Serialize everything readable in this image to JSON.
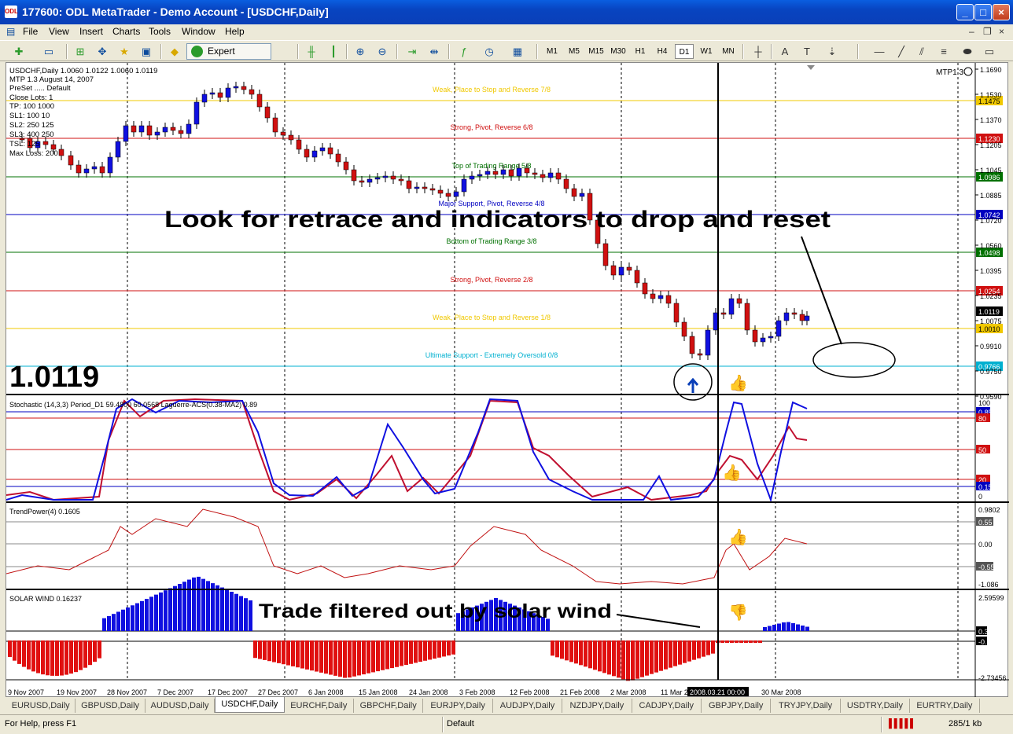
{
  "window": {
    "title": "177600: ODL MetaTrader - Demo Account - [USDCHF,Daily]",
    "app_badge": "ODL"
  },
  "menu": [
    "File",
    "View",
    "Insert",
    "Charts",
    "Tools",
    "Window",
    "Help"
  ],
  "toolbar": {
    "expert_advisors_label": "Expert Advisors",
    "timeframes": [
      "M1",
      "M5",
      "M15",
      "M30",
      "H1",
      "H4",
      "D1",
      "W1",
      "MN"
    ],
    "active_timeframe": "D1"
  },
  "chart": {
    "header_lines": [
      "USDCHF,Daily  1.0060 1.0122 1.0060 1.0119",
      "MTP 1.3  August 14, 2007",
      "PreSet ..... Default",
      "Close Lots:  1",
      "TP:  100  1000",
      "SL1:  100  10",
      "SL2:  250  125",
      "SL3:  400  250",
      "TSL:  125",
      "Max Loss:  200"
    ],
    "corner_label": "MTP1.3",
    "big_price": "1.0119",
    "annotation_main": "Look for retrace and indicators to drop and reset",
    "annotation_solar": "Trade filtered out by solar wind",
    "price_axis": [
      "1.1690",
      "1.1530",
      "1.1370",
      "1.1205",
      "1.1045",
      "1.0885",
      "1.0720",
      "1.0560",
      "1.0395",
      "1.0235",
      "1.0075",
      "0.9910",
      "0.9750",
      "0.9590"
    ],
    "levels": [
      {
        "label": "Weak, Place to Stop and Reverse  7/8",
        "price": "1.1475",
        "color": "#f0c800",
        "badge_bg": "#f0c800",
        "badge_fg": "#000"
      },
      {
        "label": "Strong, Pivot, Reverse  6/8",
        "price": "1.1230",
        "color": "#d01010",
        "badge_bg": "#d01010",
        "badge_fg": "#fff"
      },
      {
        "label": "Top of Trading Range  5/8",
        "price": "1.0986",
        "color": "#007000",
        "badge_bg": "#007000",
        "badge_fg": "#fff"
      },
      {
        "label": "Major Support, Pivot, Reverse  4/8",
        "price": "1.0742",
        "color": "#0000c0",
        "badge_bg": "#0000c0",
        "badge_fg": "#fff"
      },
      {
        "label": "Bottom of Trading Range  3/8",
        "price": "1.0498",
        "color": "#007000",
        "badge_bg": "#007000",
        "badge_fg": "#fff"
      },
      {
        "label": "Strong, Pivot, Reverse  2/8",
        "price": "1.0254",
        "color": "#d01010",
        "badge_bg": "#d01010",
        "badge_fg": "#fff"
      },
      {
        "label": "Weak, Place to Stop and Reverse  1/8",
        "price": "1.0010",
        "color": "#f0c800",
        "badge_bg": "#f0c800",
        "badge_fg": "#000"
      },
      {
        "label": "Ultimate Support - Extremely Oversold  0/8",
        "price": "0.9766",
        "color": "#00b0d0",
        "badge_bg": "#00b0d0",
        "badge_fg": "#fff"
      }
    ],
    "current_price_badge": "1.0119",
    "stochastic_label": "Stochastic (14,3,3) Period_D1 59.4800 60.0568  Laguerre-ACS(0.38-MA2) 0.89",
    "stoch_axis": [
      "100",
      "0.85",
      "80",
      "50",
      "20",
      "0.15",
      "0"
    ],
    "trendpower_label": "TrendPower(4) 0.1605",
    "trendpower_axis": [
      "0.9802",
      "0.55",
      "0.00",
      "-0.55",
      "-1.086"
    ],
    "solar_label": "SOLAR WIND 0.16237",
    "solar_axis": [
      "2.59599",
      "0.3",
      "-0.3",
      "-2.73456"
    ],
    "date_axis": [
      "9 Nov 2007",
      "19 Nov 2007",
      "28 Nov 2007",
      "7 Dec 2007",
      "17 Dec 2007",
      "27 Dec 2007",
      "6 Jan 2008",
      "15 Jan 2008",
      "24 Jan 2008",
      "3 Feb 2008",
      "12 Feb 2008",
      "21 Feb 2008",
      "2 Mar 2008",
      "11 Mar 2008",
      "30 Mar 2008"
    ],
    "cursor_date": "2008.03.21 00:00"
  },
  "tabs": [
    "EURUSD,Daily",
    "GBPUSD,Daily",
    "AUDUSD,Daily",
    "USDCHF,Daily",
    "EURCHF,Daily",
    "GBPCHF,Daily",
    "EURJPY,Daily",
    "AUDJPY,Daily",
    "NZDJPY,Daily",
    "CADJPY,Daily",
    "GBPJPY,Daily",
    "TRYJPY,Daily",
    "USDTRY,Daily",
    "EURTRY,Daily"
  ],
  "active_tab": "USDCHF,Daily",
  "status": {
    "help": "For Help, press F1",
    "profile": "Default",
    "traffic": "285/1 kb"
  },
  "colors": {
    "bull": "#1010e0",
    "bear": "#d01010",
    "titlebar": "#0a50d8"
  }
}
